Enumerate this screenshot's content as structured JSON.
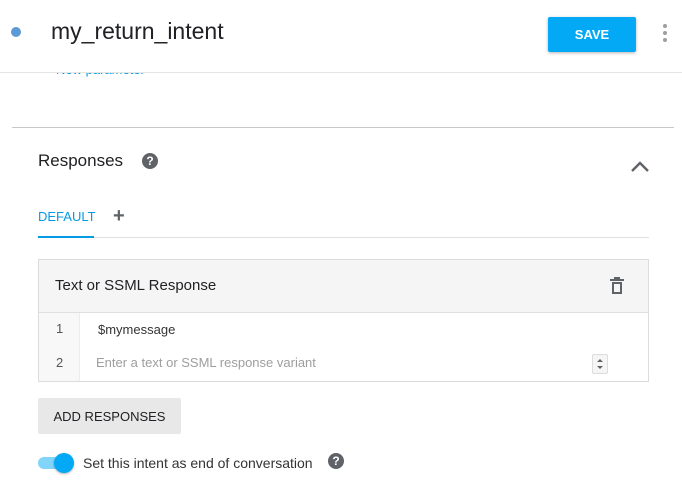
{
  "header": {
    "title": "my_return_intent",
    "save_label": "SAVE",
    "more_icon": "more-vert-icon"
  },
  "parameters": {
    "new_parameter_link": "New parameter"
  },
  "responses": {
    "title": "Responses",
    "help_glyph": "?",
    "tabs": [
      {
        "label": "DEFAULT",
        "active": true
      }
    ],
    "add_tab_glyph": "+",
    "card": {
      "title": "Text or SSML Response",
      "lines": [
        {
          "number": "1",
          "text": "$mymessage"
        },
        {
          "number": "2",
          "text": "",
          "placeholder": "Enter a text or SSML response variant"
        }
      ]
    },
    "add_responses_label": "ADD RESPONSES",
    "end_conversation": {
      "label": "Set this intent as end of conversation",
      "enabled": true
    }
  },
  "colors": {
    "accent": "#03a9f4",
    "link": "#039be5",
    "status_dot": "#5b9bd5"
  }
}
